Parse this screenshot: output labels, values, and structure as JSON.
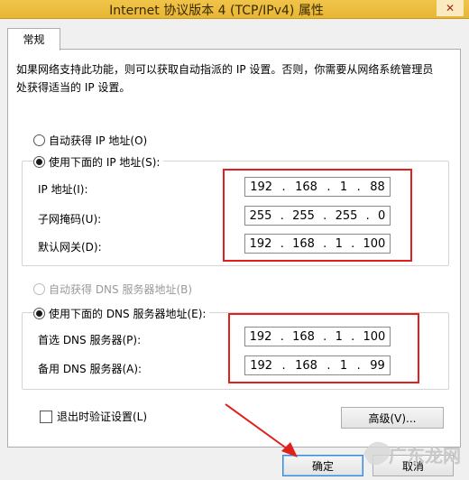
{
  "window": {
    "title": "Internet 协议版本 4 (TCP/IPv4) 属性",
    "close_icon": "close-icon"
  },
  "tab": {
    "label": "常规"
  },
  "description": "如果网络支持此功能，则可以获取自动指派的 IP 设置。否则，你需要从网络系统管理员处获得适当的 IP 设置。",
  "ip_section": {
    "auto_label": "自动获得 IP 地址(O)",
    "manual_label": "使用下面的 IP 地址(S):",
    "selected": "manual",
    "fields": [
      {
        "label": "IP 地址(I):",
        "octets": [
          "192",
          "168",
          "1",
          "88"
        ]
      },
      {
        "label": "子网掩码(U):",
        "octets": [
          "255",
          "255",
          "255",
          "0"
        ]
      },
      {
        "label": "默认网关(D):",
        "octets": [
          "192",
          "168",
          "1",
          "100"
        ]
      }
    ]
  },
  "dns_section": {
    "auto_label": "自动获得 DNS 服务器地址(B)",
    "manual_label": "使用下面的 DNS 服务器地址(E):",
    "selected": "manual",
    "fields": [
      {
        "label": "首选 DNS 服务器(P):",
        "octets": [
          "192",
          "168",
          "1",
          "100"
        ]
      },
      {
        "label": "备用 DNS 服务器(A):",
        "octets": [
          "192",
          "168",
          "1",
          "99"
        ]
      }
    ]
  },
  "validate_label": "退出时验证设置(L)",
  "advanced_label": "高级(V)...",
  "ok_label": "确定",
  "cancel_label": "取消",
  "watermark": "广东龙网",
  "colors": {
    "highlight": "#e0201a",
    "titlebar": "#f0c44a"
  }
}
